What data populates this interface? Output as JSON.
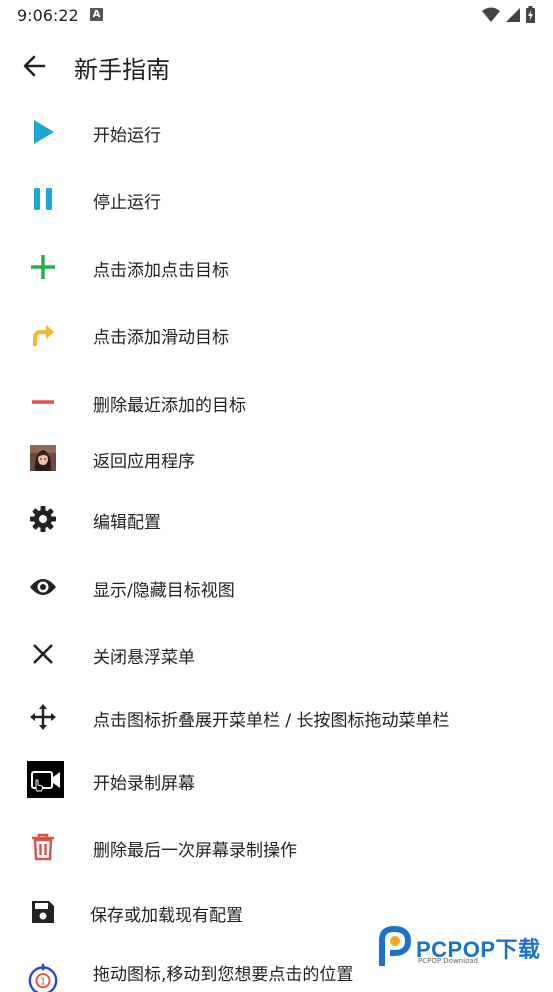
{
  "status_bar": {
    "time": "9:06:22",
    "notification_badge": "A"
  },
  "app_bar": {
    "title": "新手指南"
  },
  "guide_items": [
    {
      "label": "开始运行",
      "icon": "play-icon",
      "color": "#1ea7d6"
    },
    {
      "label": "停止运行",
      "icon": "pause-icon",
      "color": "#1ea7d6"
    },
    {
      "label": "点击添加点击目标",
      "icon": "plus-icon",
      "color": "#22b14c"
    },
    {
      "label": "点击添加滑动目标",
      "icon": "swipe-arrow-icon",
      "color": "#f5b731"
    },
    {
      "label": "删除最近添加的目标",
      "icon": "minus-icon",
      "color": "#e0504a"
    },
    {
      "label": "返回应用程序",
      "icon": "app-thumbnail-icon"
    },
    {
      "label": "编辑配置",
      "icon": "gear-icon",
      "color": "#222222"
    },
    {
      "label": "显示/隐藏目标视图",
      "icon": "eye-icon",
      "color": "#222222"
    },
    {
      "label": "关闭悬浮菜单",
      "icon": "close-icon",
      "color": "#222222"
    },
    {
      "label": "点击图标折叠展开菜单栏 / 长按图标拖动菜单栏",
      "icon": "move-icon",
      "color": "#222222"
    },
    {
      "label": "开始录制屏幕",
      "icon": "record-screen-icon",
      "color": "#000000"
    },
    {
      "label": "删除最后一次屏幕录制操作",
      "icon": "trash-icon",
      "color": "#e0504a"
    },
    {
      "label": "保存或加载现有配置",
      "icon": "save-icon",
      "color": "#222222"
    },
    {
      "label": "拖动图标,移动到您想要点击的位置",
      "icon": "target-icon",
      "color": "#3344cc"
    }
  ],
  "watermark": {
    "brand": "PCPOP下载",
    "sub": "PCPOP Download"
  }
}
